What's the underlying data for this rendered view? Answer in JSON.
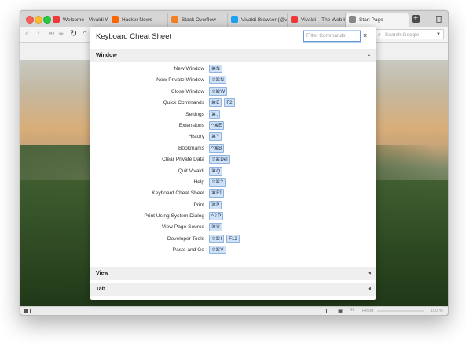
{
  "tabs": [
    {
      "title": "Welcome - Vivaldi Wo",
      "favicon": "vivaldi-icon",
      "color": "#ef3939"
    },
    {
      "title": "Hacker News",
      "favicon": "hacker-news-icon",
      "color": "#ff6600"
    },
    {
      "title": "Stack Overflow",
      "favicon": "stack-overflow-icon",
      "color": "#f48024"
    },
    {
      "title": "Vivaldi Browser (@viv",
      "favicon": "twitter-icon",
      "color": "#1da1f2"
    },
    {
      "title": "Vivaldi – The Web bro",
      "favicon": "vivaldi-icon",
      "color": "#ef3939"
    },
    {
      "title": "Start Page",
      "favicon": "start-page-icon",
      "color": "#888888"
    }
  ],
  "search": {
    "placeholder": "Search Google"
  },
  "dialog": {
    "title": "Keyboard Cheat Sheet",
    "filter_placeholder": "Filter Commands",
    "close": "×",
    "sections": [
      "Window",
      "View",
      "Tab"
    ],
    "commands": [
      {
        "label": "New Window",
        "keys": [
          "⌘N"
        ]
      },
      {
        "label": "New Private Window",
        "keys": [
          "⇧⌘N"
        ]
      },
      {
        "label": "Close Window",
        "keys": [
          "⇧⌘W"
        ]
      },
      {
        "label": "Quick Commands",
        "keys": [
          "⌘E",
          "F2"
        ]
      },
      {
        "label": "Settings",
        "keys": [
          "⌘,"
        ]
      },
      {
        "label": "Extensions",
        "keys": [
          "^⌘E"
        ]
      },
      {
        "label": "History",
        "keys": [
          "⌘Y"
        ]
      },
      {
        "label": "Bookmarks",
        "keys": [
          "^⌘B"
        ]
      },
      {
        "label": "Clear Private Data",
        "keys": [
          "⇧⌘Del"
        ]
      },
      {
        "label": "Quit Vivaldi",
        "keys": [
          "⌘Q"
        ]
      },
      {
        "label": "Help",
        "keys": [
          "⇧⌘?"
        ]
      },
      {
        "label": "Keyboard Cheat Sheet",
        "keys": [
          "⌘F1"
        ]
      },
      {
        "label": "Print",
        "keys": [
          "⌘P"
        ]
      },
      {
        "label": "Print Using System Dialog",
        "keys": [
          "^⇧P"
        ]
      },
      {
        "label": "View Page Source",
        "keys": [
          "⌘U"
        ]
      },
      {
        "label": "Developer Tools",
        "keys": [
          "⇧⌘I",
          "F12"
        ]
      },
      {
        "label": "Paste and Go",
        "keys": [
          "⇧⌘V"
        ]
      }
    ]
  },
  "statusbar": {
    "reset": "Reset",
    "zoom": "100 %"
  }
}
